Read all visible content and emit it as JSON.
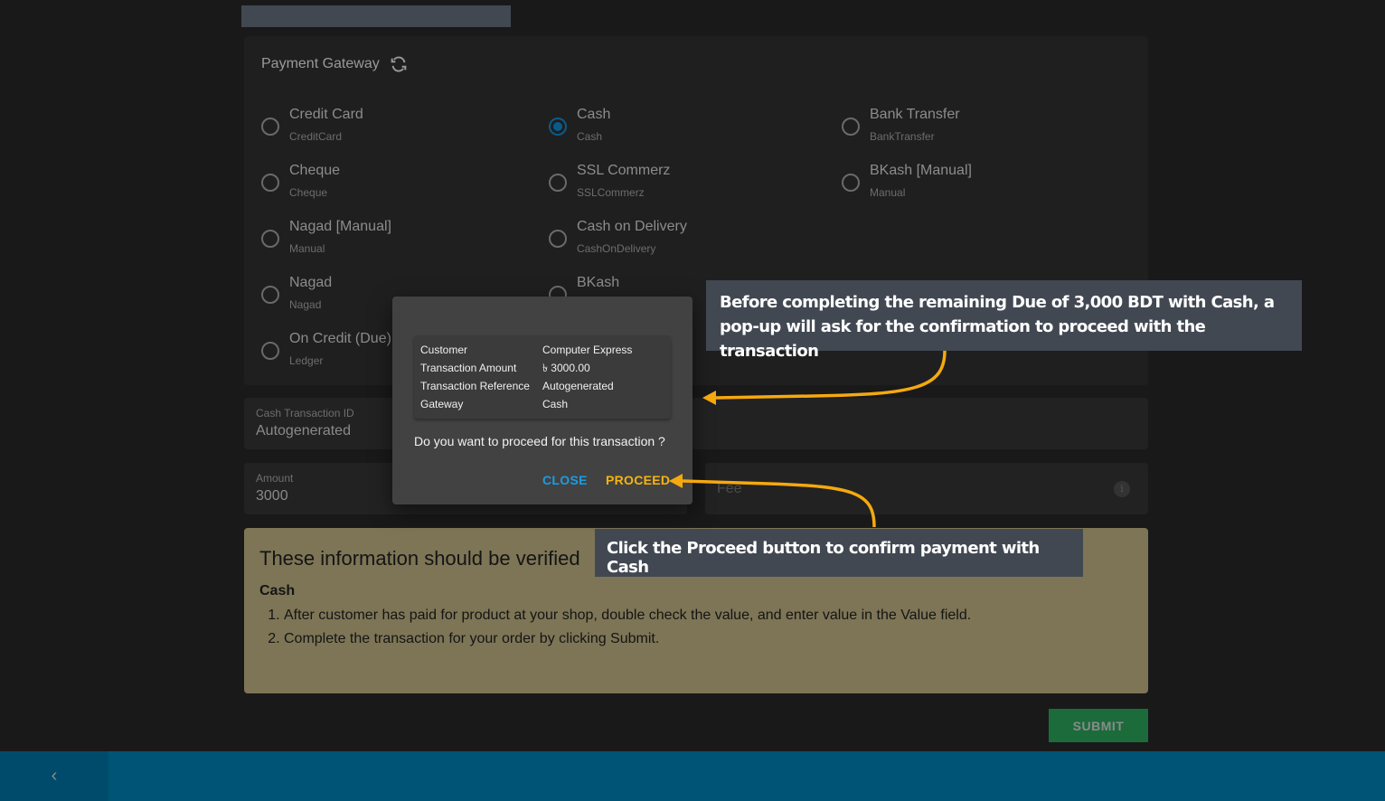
{
  "payment_gateway": {
    "title": "Payment Gateway",
    "refresh_icon": "refresh-icon",
    "options": [
      {
        "label": "Credit Card",
        "sub": "CreditCard",
        "selected": false
      },
      {
        "label": "Cash",
        "sub": "Cash",
        "selected": true
      },
      {
        "label": "Bank Transfer",
        "sub": "BankTransfer",
        "selected": false
      },
      {
        "label": "Cheque",
        "sub": "Cheque",
        "selected": false
      },
      {
        "label": "SSL Commerz",
        "sub": "SSLCommerz",
        "selected": false
      },
      {
        "label": "BKash [Manual]",
        "sub": "Manual",
        "selected": false
      },
      {
        "label": "Nagad [Manual]",
        "sub": "Manual",
        "selected": false
      },
      {
        "label": "Cash on Delivery",
        "sub": "CashOnDelivery",
        "selected": false
      },
      {
        "label": "Nagad",
        "sub": "Nagad",
        "selected": false
      },
      {
        "label": "BKash",
        "sub": "",
        "selected": false
      },
      {
        "label": "On Credit (Due)",
        "sub": "Ledger",
        "selected": false
      }
    ]
  },
  "fields": {
    "transaction_id": {
      "label": "Cash Transaction ID",
      "value": "Autogenerated"
    },
    "amount": {
      "label": "Amount",
      "value": "3000"
    },
    "fee": {
      "placeholder": "Fee"
    }
  },
  "verify": {
    "title": "These information should be verified",
    "subtitle": "Cash",
    "steps": [
      "After customer has paid for product at your shop, double check the value, and enter value in the Value field.",
      "Complete the transaction for your order by clicking Submit."
    ]
  },
  "submit_label": "SUBMIT",
  "footer": {
    "back_icon": "chevron-left-icon",
    "back_glyph": "‹"
  },
  "dialog": {
    "rows": [
      {
        "key": "Customer",
        "value": "Computer Express"
      },
      {
        "key": "Transaction Amount",
        "value": "৳ 3000.00"
      },
      {
        "key": "Transaction Reference",
        "value": "Autogenerated"
      },
      {
        "key": "Gateway",
        "value": "Cash"
      }
    ],
    "question": "Do you want to proceed for this transaction ?",
    "close_label": "CLOSE",
    "proceed_label": "PROCEED"
  },
  "callouts": [
    "Before completing the remaining Due of 3,000 BDT with Cash, a pop-up will ask for the confirmation to proceed with the transaction",
    "Click the Proceed button to confirm payment with Cash"
  ],
  "colors": {
    "accent": "#0a5b8a",
    "proceed": "#f5b412",
    "close": "#1e9be0",
    "arrow": "#f5a90f",
    "submit": "#1b6b3b",
    "footer": "#005475"
  }
}
